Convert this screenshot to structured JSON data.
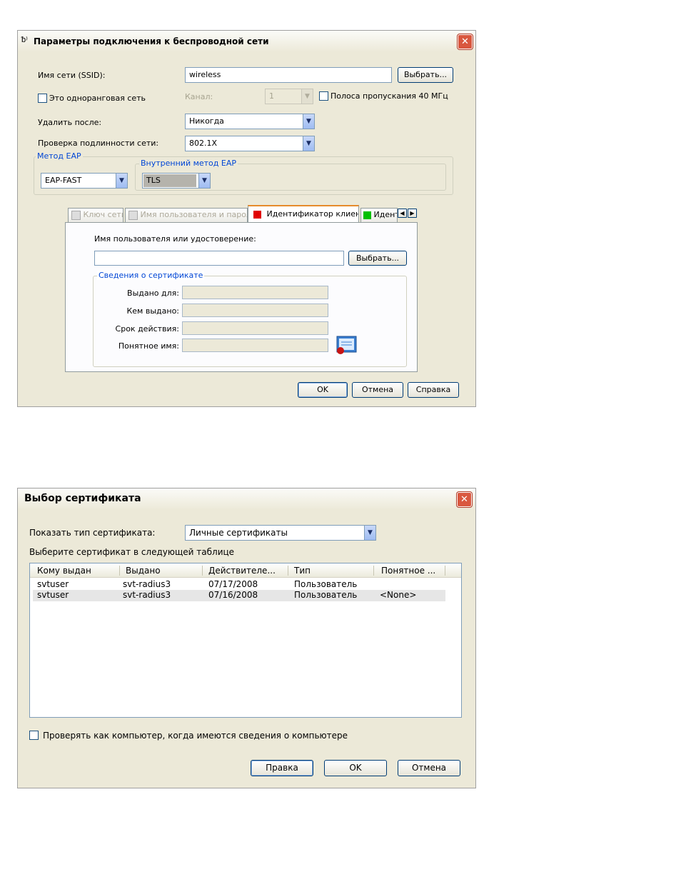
{
  "dialog1": {
    "title": "Параметры подключения к беспроводной сети",
    "ssid_label": "Имя сети (SSID):",
    "ssid_value": "wireless",
    "choose_button": "Выбрать...",
    "adhoc_label": "Это одноранговая сеть",
    "channel_label": "Канал:",
    "channel_value": "1",
    "bandwidth_label": "Полоса пропускания 40 МГц",
    "delete_after_label": "Удалить после:",
    "delete_after_value": "Никогда",
    "auth_label": "Проверка подлинности сети:",
    "auth_value": "802.1X",
    "eap_method_legend": "Метод EAP",
    "eap_method_value": "EAP-FAST",
    "inner_method_legend": "Внутренний метод EAP",
    "inner_method_value": "TLS",
    "tabs": [
      {
        "label": "Ключ сети",
        "status": "disabled"
      },
      {
        "label": "Имя пользователя и пароль",
        "status": "disabled"
      },
      {
        "label": "Идентификатор клиента",
        "status": "active",
        "color": "#e00000"
      },
      {
        "label": "Идент",
        "status": "partial",
        "color": "#00c000"
      }
    ],
    "identity_label": "Имя пользователя или удостоверение:",
    "identity_value": "",
    "identity_choose_button": "Выбрать...",
    "cert_legend": "Сведения о сертификате",
    "issued_to_label": "Выдано для:",
    "issued_by_label": "Кем выдано:",
    "expires_label": "Срок действия:",
    "friendly_label": "Понятное имя:",
    "ok_button": "OK",
    "cancel_button": "Отмена",
    "help_button": "Справка"
  },
  "dialog2": {
    "title": "Выбор сертификата",
    "cert_type_label": "Показать тип сертификата:",
    "cert_type_value": "Личные сертификаты",
    "instruction": "Выберите сертификат в следующей таблице",
    "columns": [
      "Кому выдан",
      "Выдано",
      "Действителе...",
      "Тип",
      "Понятное ..."
    ],
    "rows": [
      [
        "svtuser",
        "svt-radius3",
        "07/17/2008",
        "Пользователь",
        ""
      ],
      [
        "svtuser",
        "svt-radius3",
        "07/16/2008",
        "Пользователь",
        "<None>"
      ]
    ],
    "machine_check_label": "Проверять как компьютер, когда имеются сведения о компьютере",
    "edit_button": "Правка",
    "ok_button": "OK",
    "cancel_button": "Отмена"
  },
  "colors": {
    "dialog_bg": "#ece9d8",
    "legend_blue": "#0046d5",
    "close_red": "#d9573f",
    "tab_red": "#e00000",
    "tab_green": "#00c000"
  }
}
